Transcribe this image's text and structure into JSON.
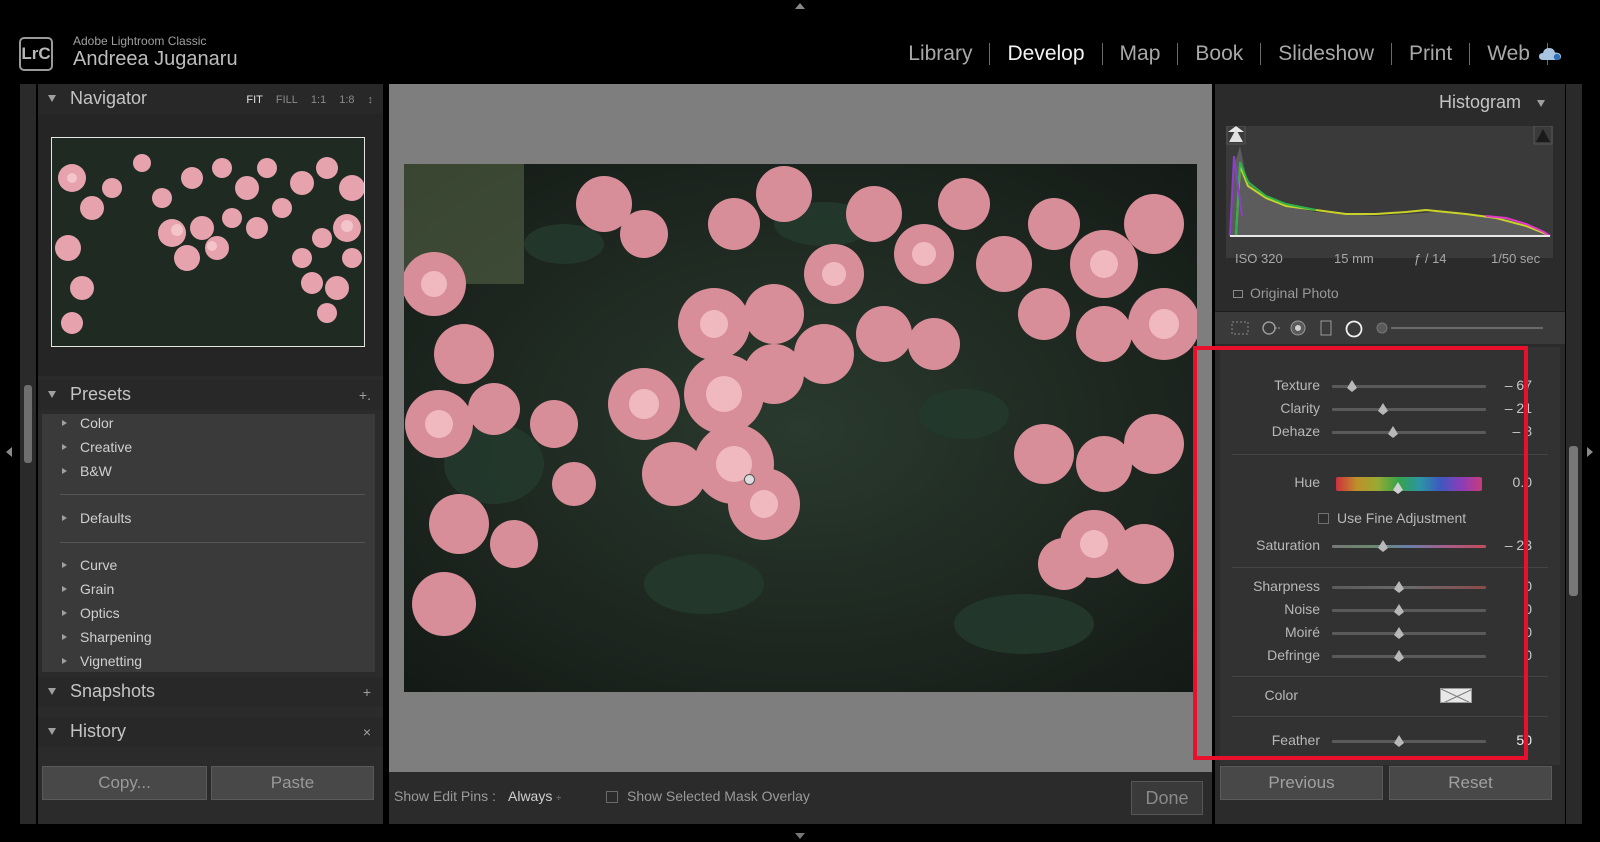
{
  "header": {
    "logo": "LrC",
    "app_name": "Adobe Lightroom Classic",
    "user_name": "Andreea Juganaru",
    "modules": [
      "Library",
      "Develop",
      "Map",
      "Book",
      "Slideshow",
      "Print",
      "Web"
    ],
    "active_module": "Develop"
  },
  "navigator": {
    "title": "Navigator",
    "zoom_options": [
      "FIT",
      "FILL",
      "1:1",
      "1:8"
    ],
    "active_zoom": "FIT"
  },
  "presets": {
    "title": "Presets",
    "add_symbol": "+.",
    "groups": [
      [
        "Color",
        "Creative",
        "B&W"
      ],
      [
        "Defaults"
      ],
      [
        "Curve",
        "Grain",
        "Optics",
        "Sharpening",
        "Vignetting"
      ]
    ]
  },
  "snapshots": {
    "title": "Snapshots",
    "action": "+"
  },
  "history": {
    "title": "History",
    "action": "×"
  },
  "left_buttons": {
    "copy": "Copy...",
    "paste": "Paste"
  },
  "toolbar": {
    "edit_pins_label": "Show Edit Pins :",
    "edit_pins_value": "Always",
    "mask_overlay_label": "Show Selected Mask Overlay",
    "done": "Done"
  },
  "histogram": {
    "title": "Histogram",
    "iso": "ISO 320",
    "focal": "15 mm",
    "aperture": "ƒ / 14",
    "shutter": "1/50 sec",
    "original_photo": "Original Photo"
  },
  "mask_panel": {
    "texture": {
      "label": "Texture",
      "value": "– 67",
      "level": -67
    },
    "clarity": {
      "label": "Clarity",
      "value": "– 21",
      "level": -21
    },
    "dehaze": {
      "label": "Dehaze",
      "value": "– 8",
      "level": -8
    },
    "hue": {
      "label": "Hue",
      "value": "0.0",
      "level": 0
    },
    "fine_adjustment": "Use Fine Adjustment",
    "saturation": {
      "label": "Saturation",
      "value": "– 23",
      "level": -23
    },
    "sharpness": {
      "label": "Sharpness",
      "value": "0",
      "level": 0
    },
    "noise": {
      "label": "Noise",
      "value": "0",
      "level": 0
    },
    "moire": {
      "label": "Moiré",
      "value": "0",
      "level": 0
    },
    "defringe": {
      "label": "Defringe",
      "value": "0",
      "level": 0
    },
    "color": {
      "label": "Color"
    },
    "feather": {
      "label": "Feather",
      "value": "50",
      "level": 50
    }
  },
  "right_buttons": {
    "previous": "Previous",
    "reset": "Reset"
  },
  "colors": {
    "highlight": "#e8102d",
    "bg": "#000000",
    "panel": "#2b2b2b"
  }
}
